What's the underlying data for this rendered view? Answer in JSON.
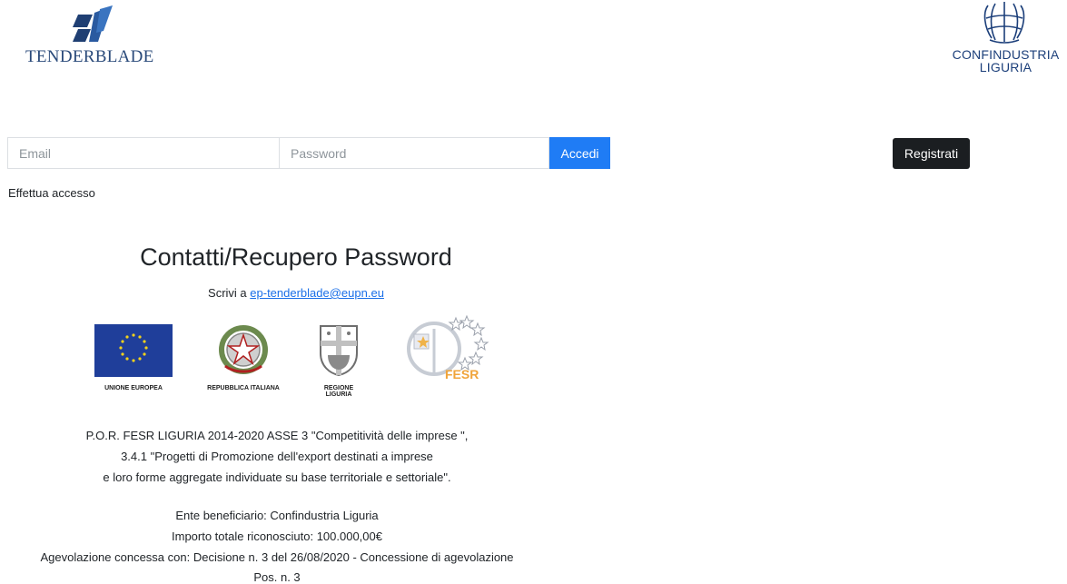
{
  "header": {
    "left_logo_text": "TENDERBLADE",
    "right_logo_line1": "CONFINDUSTRIA",
    "right_logo_line2": "LIGURIA"
  },
  "login": {
    "email_placeholder": "Email",
    "password_placeholder": "Password",
    "submit_label": "Accedi",
    "register_label": "Registrati",
    "status_text": "Effettua accesso"
  },
  "contact": {
    "title": "Contatti/Recupero Password",
    "prefix": "Scrivi a ",
    "email": "ep-tenderblade@eupn.eu"
  },
  "funding_logos": {
    "eu": "UNIONE EUROPEA",
    "italy": "REPUBBLICA ITALIANA",
    "liguria": "REGIONE LIGURIA",
    "fesr": "FESR"
  },
  "program": {
    "line1": "P.O.R. FESR LIGURIA 2014-2020 ASSE 3 \"Competitività delle imprese \",",
    "line2": "3.4.1 \"Progetti di Promozione dell'export destinati a imprese",
    "line3": "e loro forme aggregate individuate su base territoriale e settoriale\"."
  },
  "beneficiary": {
    "line1": "Ente beneficiario: Confindustria Liguria",
    "line2": "Importo totale riconosciuto: 100.000,00€",
    "line3": "Agevolazione concessa con: Decisione n. 3 del 26/08/2020 - Concessione di agevolazione",
    "line4": "Pos. n. 3"
  },
  "colors": {
    "primary_button": "#1f7cf5",
    "dark_button": "#1b1e21",
    "link": "#1a6fe8",
    "brand_blue": "#1c3f7a"
  }
}
